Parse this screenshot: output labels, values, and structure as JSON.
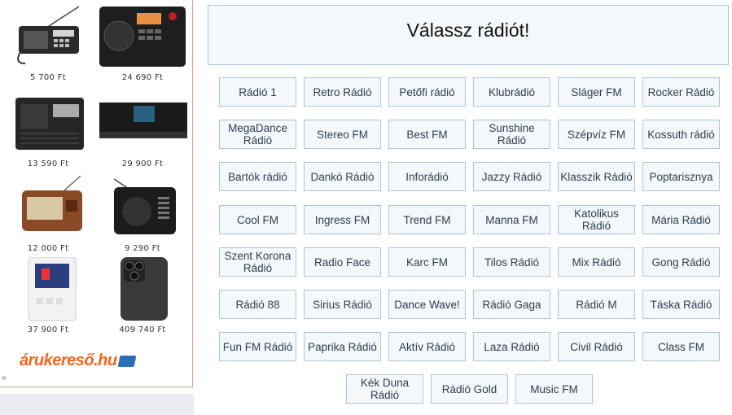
{
  "ad": {
    "products": [
      {
        "price": "5 700 Ft"
      },
      {
        "price": "24 690 Ft"
      },
      {
        "price": "13 590 Ft"
      },
      {
        "price": "29 900 Ft"
      },
      {
        "price": "12 000 Ft"
      },
      {
        "price": "9 290 Ft"
      },
      {
        "price": "37 900 Ft"
      },
      {
        "price": "409 740 Ft"
      }
    ],
    "logo_text": "árukereső.hu",
    "side_mark": "="
  },
  "main": {
    "title": "Válassz rádiót!",
    "stations": [
      "Rádió 1",
      "Retro Rádió",
      "Petőfi rádió",
      "Klubrádió",
      "Sláger FM",
      "Rocker Rádió",
      "MegaDance Rádió",
      "Stereo FM",
      "Best FM",
      "Sunshine Rádió",
      "Szépvíz FM",
      "Kossuth rádió",
      "Bartók rádió",
      "Dankó Rádió",
      "Inforádió",
      "Jazzy Rádió",
      "Klasszik Rádió",
      "Poptarisznya",
      "Cool FM",
      "Ingress FM",
      "Trend FM",
      "Manna FM",
      "Katolikus Rádió",
      "Mária Rádió",
      "Szent Korona Rádió",
      "Radio Face",
      "Karc FM",
      "Tilos Rádió",
      "Mix Rádió",
      "Gong Rádió",
      "Rádió 88",
      "Sirius Rádió",
      "Dance Wave!",
      "Rádió Gaga",
      "Rádió M",
      "Táska Rádió",
      "Fun FM Rádió",
      "Paprika Rádió",
      "Aktív Rádió",
      "Laza Rádió",
      "Civil Rádió",
      "Class FM",
      "Kék Duna Rádió",
      "Rádió Gold",
      "Music FM"
    ]
  }
}
